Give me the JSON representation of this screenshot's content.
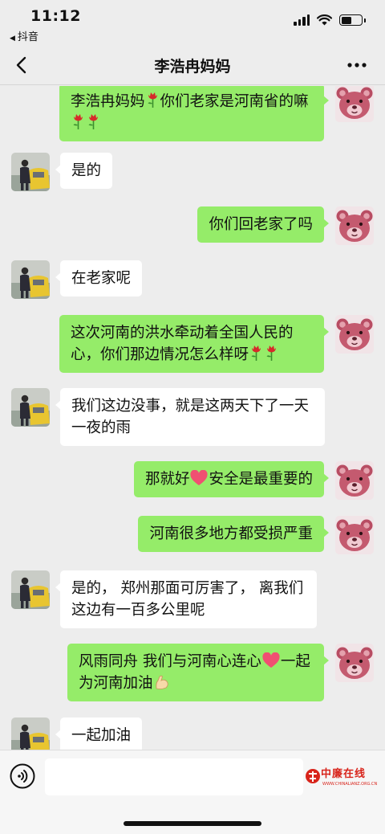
{
  "status_bar": {
    "time": "11:12",
    "back_app": "抖音",
    "back_arrow": "◀",
    "battery_level": 0.52
  },
  "nav": {
    "title": "李浩冉妈妈",
    "back_icon": "chevron-left-icon",
    "more_icon": "more-dots-icon"
  },
  "messages": [
    {
      "side": "out",
      "parts": [
        "李浩冉妈妈",
        "#rose",
        "你们老家是河南省的嘛",
        "#rose",
        "#rose"
      ]
    },
    {
      "side": "in",
      "parts": [
        "是的"
      ]
    },
    {
      "side": "out",
      "parts": [
        "你们回老家了吗"
      ]
    },
    {
      "side": "in",
      "parts": [
        "在老家呢"
      ]
    },
    {
      "side": "out",
      "parts": [
        "这次河南的洪水牵动着全国人民的心，你们那边情况怎么样呀",
        "#rose",
        "#rose"
      ]
    },
    {
      "side": "in",
      "parts": [
        "我们这边没事，就是这两天下了一天一夜的雨"
      ]
    },
    {
      "side": "out",
      "parts": [
        "那就好",
        "#heart",
        "安全是最重要的"
      ]
    },
    {
      "side": "out",
      "parts": [
        "河南很多地方都受损严重"
      ]
    },
    {
      "side": "in",
      "parts": [
        "是的， 郑州那面可厉害了， 离我们这边有一百多公里呢"
      ]
    },
    {
      "side": "out",
      "parts": [
        "风雨同舟 我们与河南心连心",
        "#heart",
        "一起为河南加油",
        "#muscle"
      ]
    },
    {
      "side": "in",
      "parts": [
        "一起加油"
      ]
    }
  ],
  "input": {
    "voice_icon": "voice-icon",
    "value": ""
  },
  "watermark": {
    "text": "中廉在线",
    "url": "WWW.CHINALIANZ.ORG.CN"
  },
  "colors": {
    "background": "#ededed",
    "outgoing_bubble": "#95ec69",
    "incoming_bubble": "#ffffff",
    "watermark": "#d8241b"
  }
}
